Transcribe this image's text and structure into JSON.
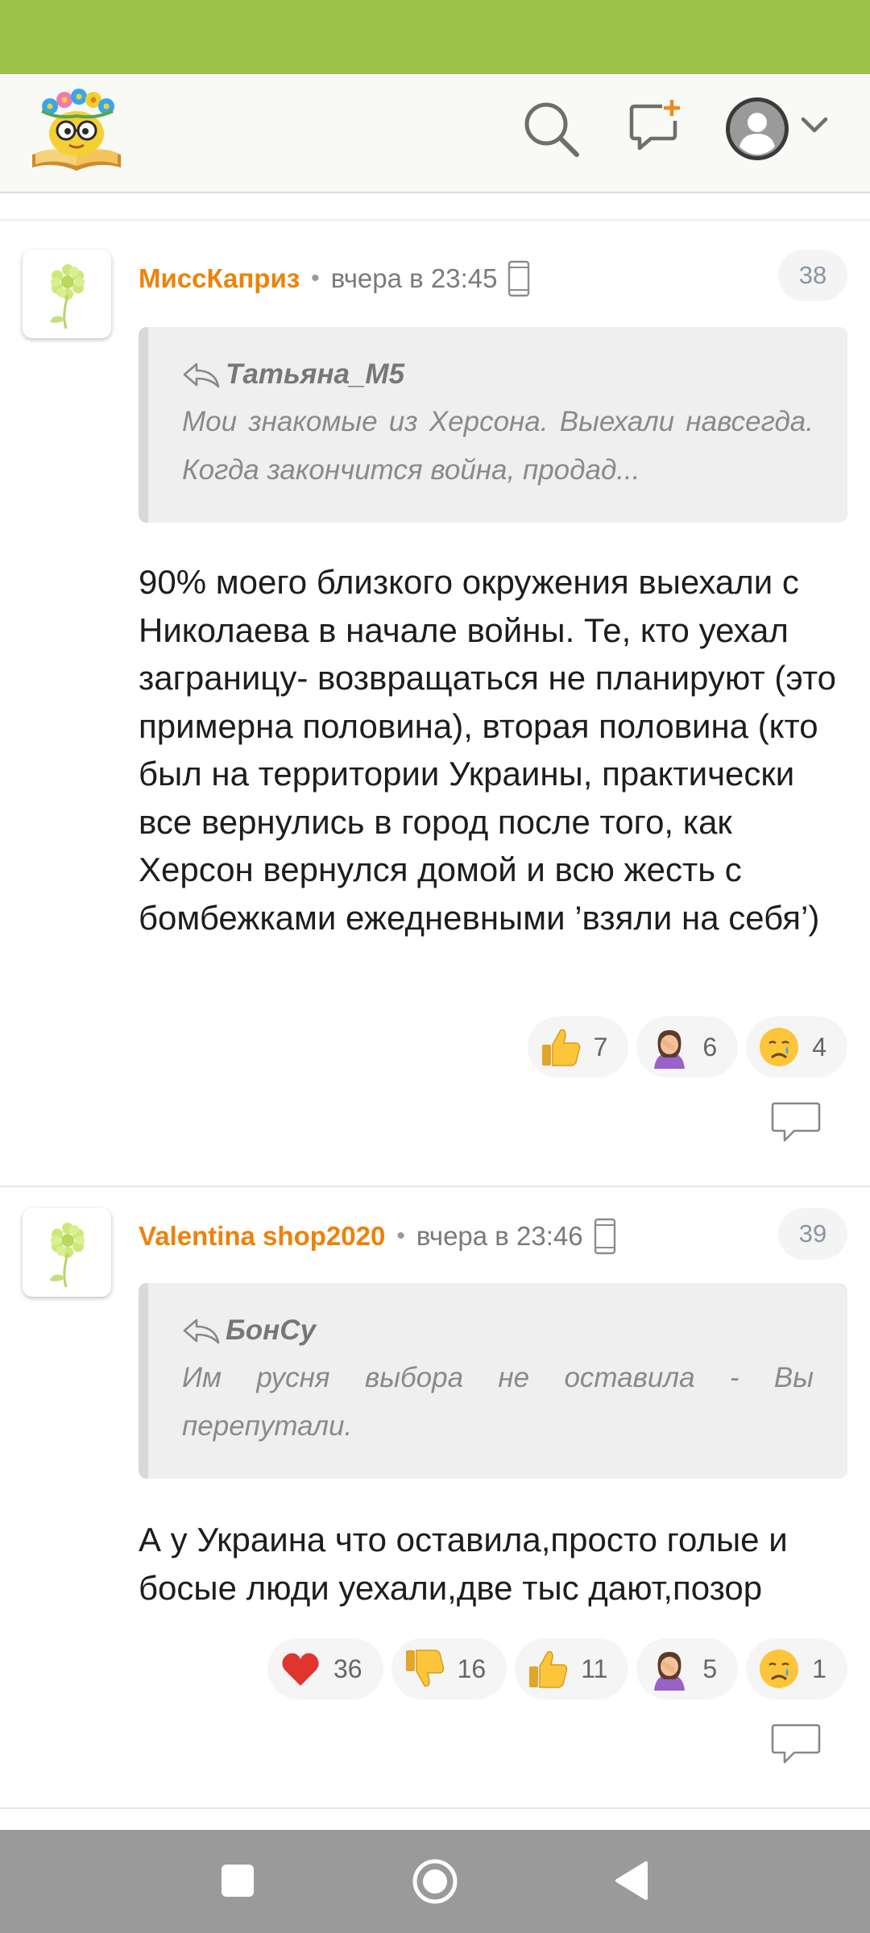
{
  "header": {
    "logo": "reading-flower-logo",
    "icons": [
      "search-icon",
      "new-post-icon",
      "profile-avatar-icon",
      "chevron-down-icon"
    ]
  },
  "comments": [
    {
      "author": "МиссКаприз",
      "time": "вчера в 23:45",
      "number": "38",
      "quote": {
        "author": "Татьяна_М5",
        "text": "Мои знакомые из Херсона. Выехали навсегда. Когда закончится война, продад..."
      },
      "text": "90% моего близкого окружения выехали с Николаева в начале войны. Те, кто уехал заграницу- возвращаться не планируют (это примерна половина), вторая половина (кто был на территории Украины, практически все вернулись в город после того, как Херсон вернулся домой и всю жесть с бомбежками ежедневными ’взяли на себя’)",
      "reactions": [
        {
          "icon": "thumbs-up",
          "count": "7"
        },
        {
          "icon": "facepalm",
          "count": "6"
        },
        {
          "icon": "crying-face",
          "count": "4"
        }
      ]
    },
    {
      "author": "Valentina shop2020",
      "time": "вчера в 23:46",
      "number": "39",
      "quote": {
        "author": "БонСу",
        "text": "Им русня выбора не оставила - Вы перепутали."
      },
      "text": "А у Украина что оставила,просто голые и босые люди уехали,две тыс дают,позор",
      "reactions": [
        {
          "icon": "red-heart",
          "count": "36"
        },
        {
          "icon": "thumbs-down",
          "count": "16"
        },
        {
          "icon": "thumbs-up",
          "count": "11"
        },
        {
          "icon": "facepalm",
          "count": "5"
        },
        {
          "icon": "crying-face",
          "count": "1"
        }
      ]
    }
  ],
  "navbar": {
    "icons": [
      "recents-square-icon",
      "home-circle-icon",
      "back-triangle-icon"
    ]
  },
  "colors": {
    "status_bar": "#9dc146",
    "author": "#ee8208",
    "navbar": "#9a9a9a"
  }
}
